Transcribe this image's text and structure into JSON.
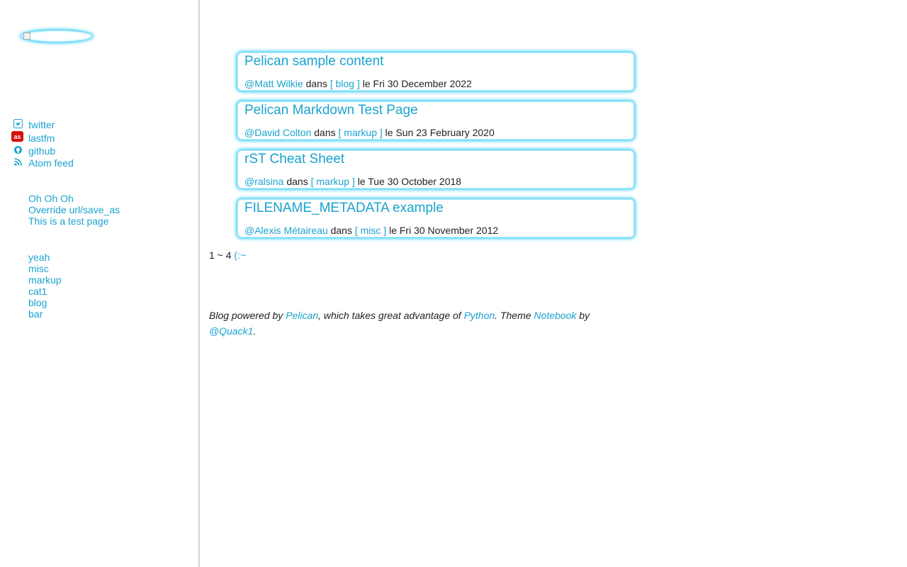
{
  "sidebar": {
    "social": [
      {
        "label": "twitter",
        "icon": "twitter-icon"
      },
      {
        "label": "lastfm",
        "icon": "lastfm-icon"
      },
      {
        "label": "github",
        "icon": "github-icon"
      },
      {
        "label": "Atom feed",
        "icon": "rss-icon"
      }
    ],
    "pages": [
      "Oh Oh Oh",
      "Override url/save_as",
      "This is a test page"
    ],
    "categories": [
      "yeah",
      "misc",
      "markup",
      "cat1",
      "blog",
      "bar"
    ]
  },
  "articles": [
    {
      "title": "Pelican sample content",
      "author": "@Matt Wilkie",
      "dans": "dans",
      "category": "[ blog ]",
      "date": "le Fri 30 December 2022"
    },
    {
      "title": "Pelican Markdown Test Page",
      "author": "@David Colton",
      "dans": "dans",
      "category": "[ markup ]",
      "date": "le Sun 23 February 2020"
    },
    {
      "title": "rST Cheat Sheet",
      "author": "@ralsina",
      "dans": "dans",
      "category": "[ markup ]",
      "date": "le Tue 30 October 2018"
    },
    {
      "title": "FILENAME_METADATA example",
      "author": "@Alexis Métaireau",
      "dans": "dans",
      "category": "[ misc ]",
      "date": "le Fri 30 November 2012"
    }
  ],
  "pager": {
    "range": "1 ~ 4",
    "next": "(:~"
  },
  "footer": {
    "prefix": "Blog powered by",
    "pelican": "Pelican",
    "middle": ", which takes great advantage of",
    "python": "Python",
    "theme": ". Theme",
    "notebook": "Notebook",
    "by": "by",
    "author": "@Quack1",
    "end": "."
  },
  "colors": {
    "link": "#1aa3cf",
    "glow": "#3fd0f6",
    "lastfm": "#d51007"
  }
}
